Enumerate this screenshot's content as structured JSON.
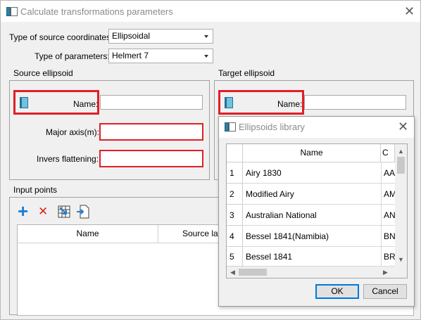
{
  "window": {
    "title": "Calculate transformations parameters",
    "close_glyph": "✕"
  },
  "form": {
    "source_coords_label": "Type of source coordinates:",
    "source_coords_value": "Ellipsoidal",
    "params_label": "Type of parameters:",
    "params_value": "Helmert 7"
  },
  "source_ellipsoid": {
    "title": "Source ellipsoid",
    "name_label": "Name:",
    "major_axis_label": "Major axis(m):",
    "inv_flattening_label": "Invers flattening:"
  },
  "target_ellipsoid": {
    "title": "Target ellipsoid",
    "name_label": "Name:"
  },
  "input_points": {
    "title": "Input points",
    "add_glyph": "+",
    "remove_glyph": "✕",
    "columns": [
      "Name",
      "Source lat"
    ]
  },
  "library": {
    "title": "Ellipsoids library",
    "close_glyph": "✕",
    "columns": [
      "Name",
      "C"
    ],
    "rows": [
      {
        "num": "1",
        "name": "Airy 1830",
        "code": "AA"
      },
      {
        "num": "2",
        "name": "Modified Airy",
        "code": "AM"
      },
      {
        "num": "3",
        "name": "Australian National",
        "code": "AN"
      },
      {
        "num": "4",
        "name": "Bessel 1841(Namibia)",
        "code": "BN"
      },
      {
        "num": "5",
        "name": "Bessel 1841",
        "code": "BR"
      }
    ],
    "ok_label": "OK",
    "cancel_label": "Cancel"
  },
  "icons": {
    "app": "window-icon",
    "name_field": "book-icon",
    "add": "plus-icon",
    "remove": "delete-x-icon",
    "import": "import-table-icon",
    "export": "export-file-icon"
  },
  "colors": {
    "highlight_red": "#e01f26",
    "add_blue": "#1f7fd1",
    "remove_red": "#e02020",
    "ok_border": "#0078d7"
  }
}
